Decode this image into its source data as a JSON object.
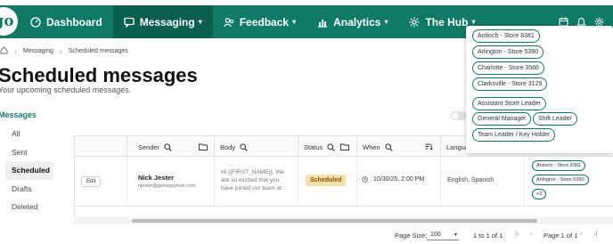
{
  "header": {
    "logo_text": "go",
    "nav": [
      {
        "label": "Dashboard",
        "icon": "dashboard-icon",
        "has_caret": false,
        "active": false
      },
      {
        "label": "Messaging",
        "icon": "chat-icon",
        "has_caret": true,
        "active": true
      },
      {
        "label": "Feedback",
        "icon": "people-icon",
        "has_caret": true,
        "active": false
      },
      {
        "label": "Analytics",
        "icon": "bar-chart-icon",
        "has_caret": true,
        "active": false
      },
      {
        "label": "The Hub",
        "icon": "gear-hub-icon",
        "has_caret": true,
        "active": false
      }
    ],
    "right_icons": [
      "calendar-icon",
      "bell-icon",
      "settings-icon"
    ],
    "accent_color": "#0f7a66"
  },
  "breadcrumb": {
    "items": [
      "Messaging",
      "Scheduled messages"
    ]
  },
  "page": {
    "title": "Scheduled messages",
    "subtitle": "Your upcoming scheduled messages."
  },
  "sidebar": {
    "heading": "Messages",
    "items": [
      {
        "label": "All",
        "active": false
      },
      {
        "label": "Sent",
        "active": false
      },
      {
        "label": "Scheduled",
        "active": true
      },
      {
        "label": "Drafts",
        "active": false
      },
      {
        "label": "Deleted",
        "active": false
      }
    ]
  },
  "table": {
    "columns": {
      "sender": "Sender",
      "body": "Body",
      "status": "Status",
      "when": "When",
      "language": "Langua"
    },
    "row": {
      "edit_label": "Edit",
      "sender_name": "Nick Jester",
      "sender_email": "njester@gohappyhub.com",
      "body_preview": "Hi {{FIRST_NAME}}, We are so excited that you have joined our team at...",
      "status": "Scheduled",
      "when": "10/30/25, 2:00 PM",
      "language": "English, Spanish",
      "locations": [
        "Antioch - Store 8381",
        "Arlington - Store 5390",
        "+2"
      ]
    }
  },
  "pagination": {
    "page_size_label": "Page Size:",
    "page_size": "100",
    "range": "1 to 1 of 1",
    "page_text": "Page 1 of 1"
  },
  "dropdown": {
    "locations": [
      "Antioch - Store 8381",
      "Arlington - Store 5390",
      "Charlotte - Store 3566",
      "Clarksville - Store 3129"
    ],
    "roles": [
      "Assistant Store Leader",
      "General Manager",
      "Shift Leader",
      "Team Leader / Key Holder"
    ]
  }
}
